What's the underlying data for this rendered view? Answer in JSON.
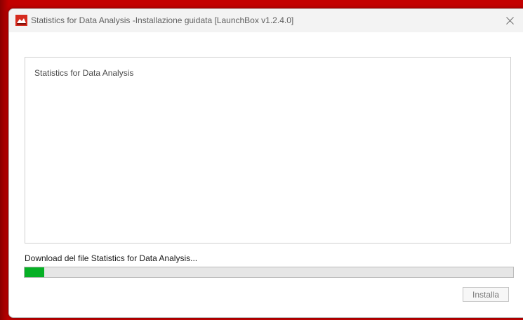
{
  "window": {
    "title": "Statistics for Data Analysis -Installazione guidata [LaunchBox v1.2.4.0]",
    "close_icon": "close-icon",
    "app_icon": "app-icon"
  },
  "panel": {
    "title": "Statistics for Data Analysis"
  },
  "status": {
    "text": "Download del file Statistics for Data Analysis..."
  },
  "progress": {
    "value_fraction": 0.04,
    "fill_color": "#06b025",
    "track_color": "#e6e6e6"
  },
  "buttons": {
    "install_label": "Installa"
  },
  "colors": {
    "backdrop": "#c40000",
    "accent": "#06b025"
  }
}
